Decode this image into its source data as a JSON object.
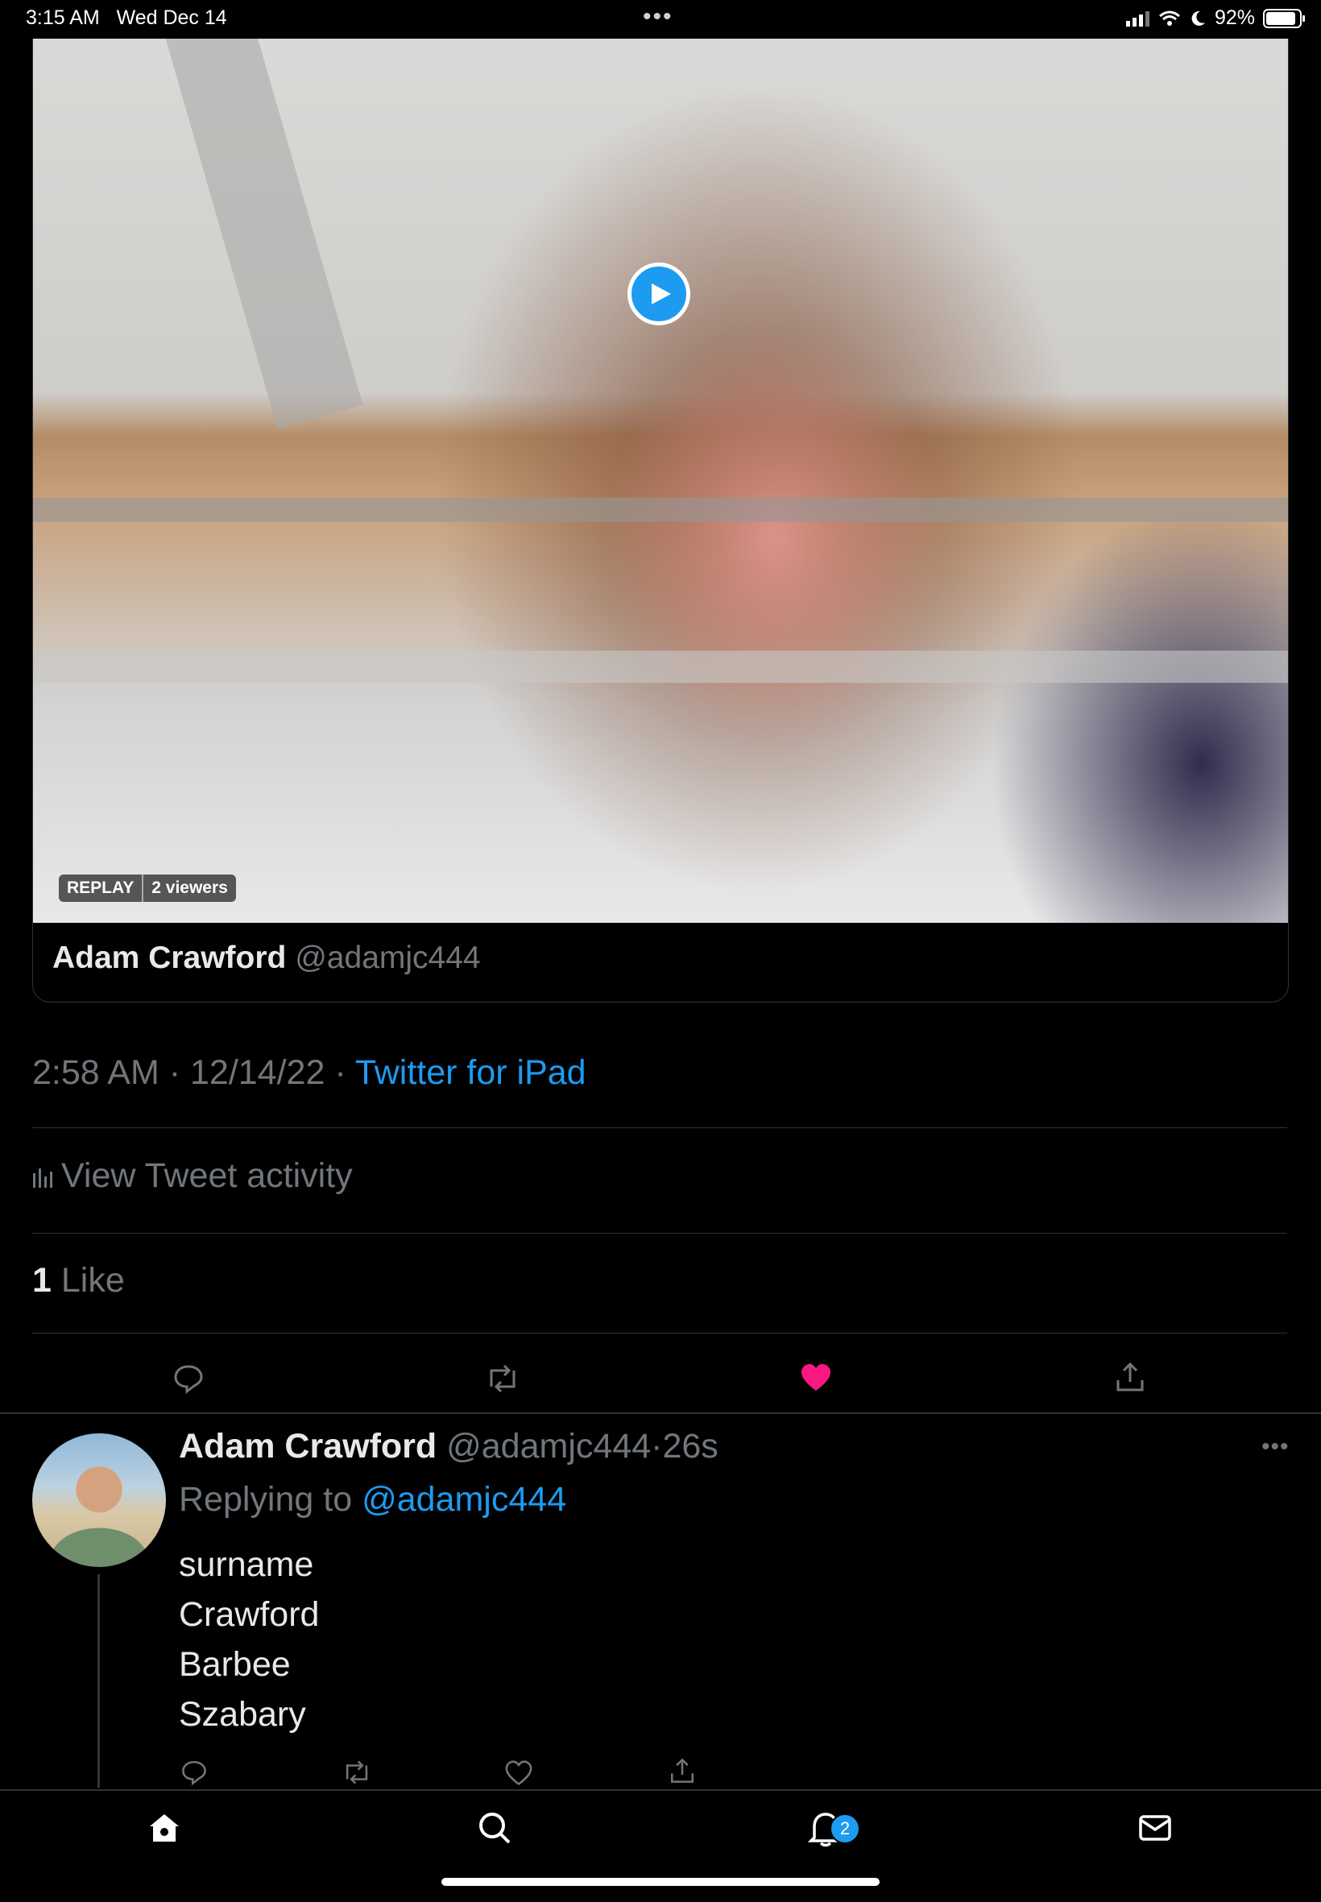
{
  "status_bar": {
    "time": "3:15 AM",
    "date": "Wed Dec 14",
    "battery": "92%",
    "dots": "•••"
  },
  "video": {
    "replay_label": "REPLAY",
    "viewers_label": "2 viewers",
    "play_icon": "play-icon"
  },
  "card": {
    "author_name": "Adam Crawford",
    "author_handle": "@adamjc444"
  },
  "tweet_meta": {
    "time": "2:58 AM",
    "date": "12/14/22",
    "separator": " · ",
    "source": "Twitter for iPad"
  },
  "activity": {
    "label": "View Tweet activity"
  },
  "likes": {
    "count": "1",
    "label": "Like"
  },
  "reply": {
    "author_name": "Adam Crawford",
    "author_handle": "@adamjc444",
    "age": "26s",
    "replying_prefix": "Replying to",
    "replying_handle": "@adamjc444",
    "lines": [
      "surname",
      "Crawford",
      "Barbee",
      "Szabary"
    ]
  },
  "tabbar": {
    "notification_count": "2"
  },
  "colors": {
    "accent": "#1d9bf0",
    "like": "#f91880",
    "muted": "#71767b"
  }
}
